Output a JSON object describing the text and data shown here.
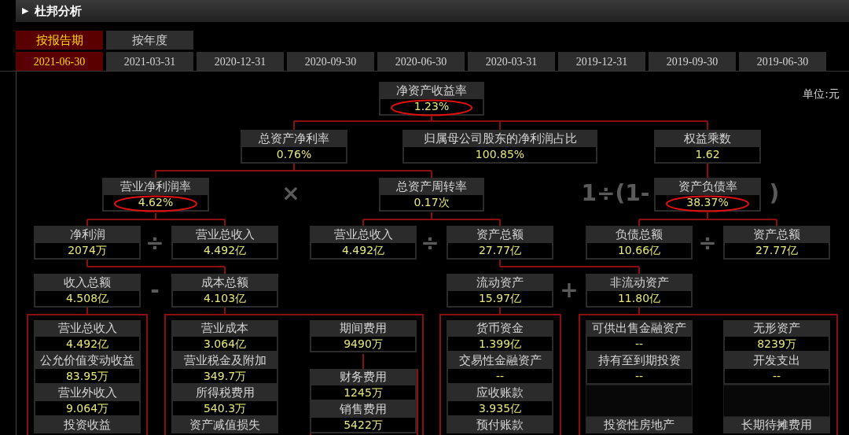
{
  "panel": {
    "toggle": "▶",
    "title": "杜邦分析"
  },
  "period_tabs": [
    {
      "label": "按报告期",
      "selected": true
    },
    {
      "label": "按年度",
      "selected": false
    }
  ],
  "date_tabs": [
    {
      "label": "2021-06-30",
      "selected": true
    },
    {
      "label": "2021-03-31",
      "selected": false
    },
    {
      "label": "2020-12-31",
      "selected": false
    },
    {
      "label": "2020-09-30",
      "selected": false
    },
    {
      "label": "2020-06-30",
      "selected": false
    },
    {
      "label": "2020-03-31",
      "selected": false
    },
    {
      "label": "2019-12-31",
      "selected": false
    },
    {
      "label": "2019-09-30",
      "selected": false
    },
    {
      "label": "2019-06-30",
      "selected": false
    }
  ],
  "unit": "单位:元",
  "nodes": [
    {
      "label": "净资产收益率",
      "value": "1.23%",
      "circled": true
    },
    {
      "label": "总资产净利率",
      "value": "0.76%",
      "circled": false
    },
    {
      "label": "归属母公司股东的净利润占比",
      "value": "100.85%",
      "circled": false
    },
    {
      "label": "权益乘数",
      "value": "1.62",
      "circled": false
    },
    {
      "label": "营业净利润率",
      "value": "4.62%",
      "circled": true
    },
    {
      "label": "总资产周转率",
      "value": "0.17次",
      "circled": false
    },
    {
      "label": "资产负债率",
      "value": "38.37%",
      "circled": true
    },
    {
      "label": "净利润",
      "value": "2074万",
      "circled": false
    },
    {
      "label": "营业总收入",
      "value": "4.492亿",
      "circled": false
    },
    {
      "label": "营业总收入",
      "value": "4.492亿",
      "circled": false
    },
    {
      "label": "资产总额",
      "value": "27.77亿",
      "circled": false
    },
    {
      "label": "负债总额",
      "value": "10.66亿",
      "circled": false
    },
    {
      "label": "资产总额",
      "value": "27.77亿",
      "circled": false
    },
    {
      "label": "收入总额",
      "value": "4.508亿",
      "circled": false
    },
    {
      "label": "成本总额",
      "value": "4.103亿",
      "circled": false
    },
    {
      "label": "流动资产",
      "value": "15.97亿",
      "circled": false
    },
    {
      "label": "非流动资产",
      "value": "11.80亿",
      "circled": false
    }
  ],
  "operators": [
    "×",
    "1÷(1-",
    ")",
    "÷",
    "÷",
    "÷",
    "-",
    "+"
  ],
  "columns": [
    {
      "items": [
        {
          "label": "营业总收入",
          "value": "4.492亿"
        },
        {
          "label": "公允价值变动收益",
          "value": "83.95万"
        },
        {
          "label": "营业外收入",
          "value": "9.064万"
        },
        {
          "label": "投资收益"
        }
      ]
    },
    {
      "items": [
        {
          "label": "营业成本",
          "value": "3.064亿"
        },
        {
          "label": "营业税金及附加",
          "value": "349.7万"
        },
        {
          "label": "所得税费用",
          "value": "540.3万"
        },
        {
          "label": "资产减值损失"
        }
      ]
    },
    {
      "items": [
        {
          "label": "期间费用",
          "value": "9490万"
        }
      ],
      "sub_items": [
        {
          "label": "财务费用",
          "value": "1245万"
        },
        {
          "label": "销售费用",
          "value": "5422万"
        }
      ]
    },
    {
      "items": [
        {
          "label": "货币资金",
          "value": "1.399亿"
        },
        {
          "label": "交易性金融资产",
          "value": "--"
        },
        {
          "label": "应收账款",
          "value": "3.935亿"
        },
        {
          "label": "预付账款"
        }
      ]
    },
    {
      "items": [
        {
          "label": "可供出售金融资产",
          "value": "--"
        },
        {
          "label": "持有至到期投资",
          "value": "--"
        },
        {
          "redacted": true
        },
        {
          "label": "投资性房地产"
        }
      ]
    },
    {
      "items": [
        {
          "label": "无形资产",
          "value": "8239万"
        },
        {
          "label": "开发支出",
          "value": "--"
        },
        {
          "redacted": true
        },
        {
          "label": "长期待摊费用"
        }
      ]
    }
  ]
}
